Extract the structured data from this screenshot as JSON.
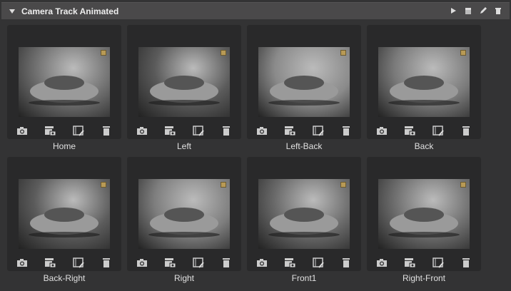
{
  "panel": {
    "title": "Camera Track Animated",
    "actions": [
      "play-icon",
      "clapper-icon",
      "pencil-icon",
      "trash-icon"
    ]
  },
  "cameras": [
    {
      "label": "Home",
      "bg": "#6e6e6e"
    },
    {
      "label": "Left",
      "bg": "#5a5a5a"
    },
    {
      "label": "Left-Back",
      "bg": "#8a8a8a"
    },
    {
      "label": "Back",
      "bg": "#7a7a7a"
    },
    {
      "label": "Back-Right",
      "bg": "#5c5c5c"
    },
    {
      "label": "Right",
      "bg": "#7e7e7e"
    },
    {
      "label": "Front1",
      "bg": "#6a6a6a"
    },
    {
      "label": "Right-Front",
      "bg": "#6e6e6e"
    }
  ],
  "card_actions": [
    "camera-icon",
    "clapper-camera-icon",
    "film-edit-icon",
    "trash-icon"
  ]
}
